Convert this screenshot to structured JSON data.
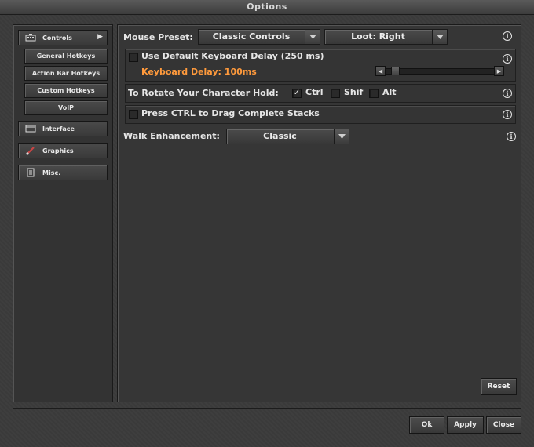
{
  "window": {
    "title": "Options"
  },
  "sidebar": {
    "controls": "Controls",
    "sub_items": [
      "General Hotkeys",
      "Action Bar Hotkeys",
      "Custom Hotkeys",
      "VoIP"
    ],
    "interface": "Interface",
    "graphics": "Graphics",
    "misc": "Misc."
  },
  "mouse_preset": {
    "label": "Mouse Preset:",
    "preset_value": "Classic Controls",
    "loot_value": "Loot: Right"
  },
  "keyboard_delay": {
    "checkbox_label": "Use Default Keyboard Delay (250 ms)",
    "checked": false,
    "delay_text": "Keyboard Delay: 100ms",
    "slider_level": 0.05
  },
  "rotate": {
    "label": "To Rotate Your Character Hold:",
    "ctrl": {
      "label": "Ctrl",
      "checked": true
    },
    "shift": {
      "label": "Shif",
      "checked": false
    },
    "alt": {
      "label": "Alt",
      "checked": false
    }
  },
  "drag_stacks": {
    "label": "Press CTRL to Drag Complete Stacks",
    "checked": false
  },
  "walk": {
    "label": "Walk Enhancement:",
    "value": "Classic"
  },
  "buttons": {
    "reset": "Reset",
    "ok": "Ok",
    "apply": "Apply",
    "close": "Close"
  },
  "icons": {
    "info": "i",
    "check": "✓"
  },
  "colors": {
    "accent_orange": "#ff9a3c"
  }
}
